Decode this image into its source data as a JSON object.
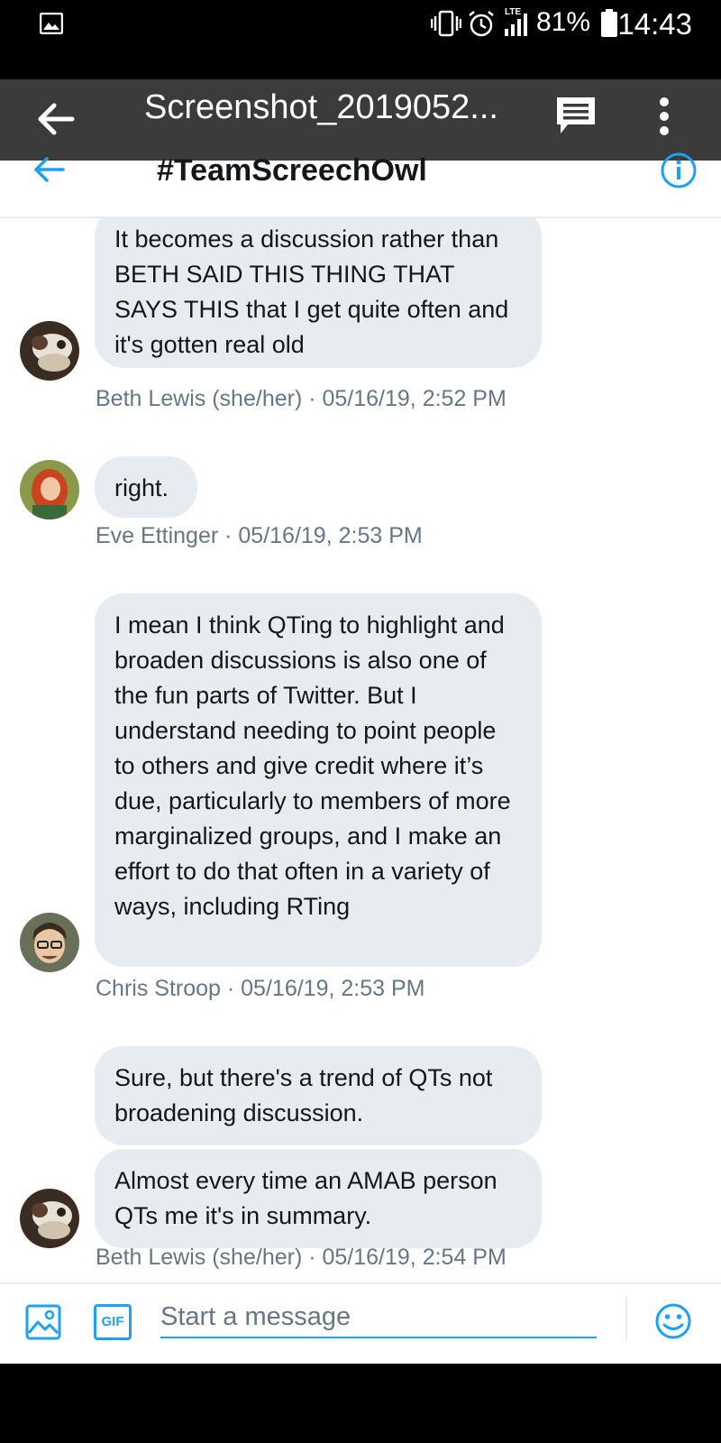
{
  "status_bar": {
    "battery_percent": "81%",
    "time": "14:43",
    "network": "LTE"
  },
  "viewer": {
    "title": "Screenshot_2019052..."
  },
  "conversation": {
    "title": "#TeamScreechOwl"
  },
  "messages": [
    {
      "sender": "Beth Lewis (she/her)",
      "bubbles": [
        "It becomes a discussion rather than BETH SAID THIS THING THAT SAYS THIS that I get quite often and it's gotten real old"
      ],
      "meta": "Beth Lewis (she/her) · 05/16/19, 2:52 PM"
    },
    {
      "sender": "Eve Ettinger",
      "bubbles": [
        "right."
      ],
      "meta": "Eve Ettinger · 05/16/19, 2:53 PM"
    },
    {
      "sender": "Chris Stroop",
      "bubbles": [
        "I mean I think QTing to highlight and broaden discussions is also one of the fun parts of Twitter. But I understand needing to point people to others and give credit where it’s due, particularly to members of more marginalized groups, and I make an effort to do that often in a variety of ways, including RTing"
      ],
      "meta": "Chris Stroop · 05/16/19, 2:53 PM"
    },
    {
      "sender": "Beth Lewis (she/her)",
      "bubbles": [
        "Sure, but there's a trend of QTs not broadening discussion.",
        "Almost every time an AMAB person QTs me it's in summary."
      ],
      "meta": "Beth Lewis (she/her) · 05/16/19, 2:54 PM"
    }
  ],
  "composer": {
    "placeholder": "Start a message",
    "gif_label": "GIF"
  },
  "colors": {
    "accent": "#1da1f2",
    "bubble": "#e6ecf0",
    "meta_text": "#657786"
  }
}
